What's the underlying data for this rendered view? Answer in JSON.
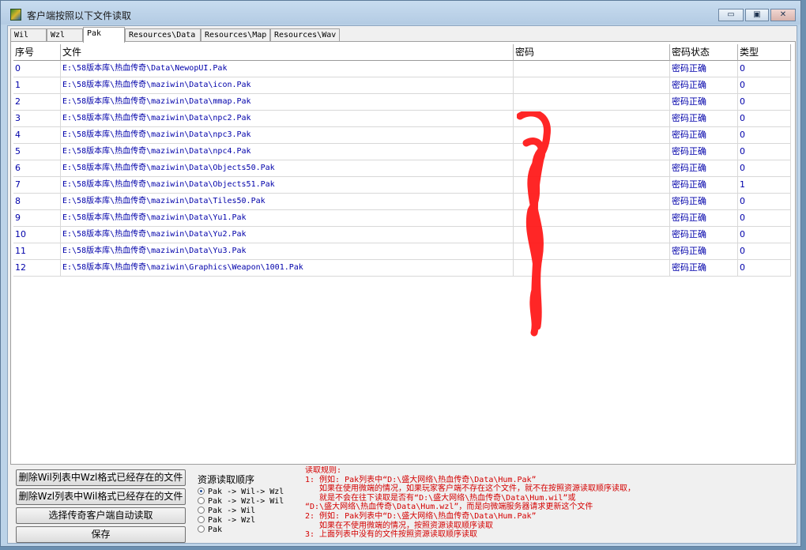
{
  "window": {
    "title": "客户端按照以下文件读取",
    "minimize_label": "▭",
    "maximize_label": "▣",
    "close_label": "✕"
  },
  "tabs": [
    {
      "label": "Wil"
    },
    {
      "label": "Wzl"
    },
    {
      "label": "Pak",
      "active": true
    },
    {
      "label": "Resources\\Data"
    },
    {
      "label": "Resources\\Map"
    },
    {
      "label": "Resources\\Wav"
    }
  ],
  "table": {
    "headers": [
      "序号",
      "文件",
      "密码",
      "密码状态",
      "类型"
    ],
    "rows": [
      {
        "index": "0",
        "file": "E:\\58版本库\\热血传奇\\Data\\NewopUI.Pak",
        "password": "",
        "status": "密码正确",
        "type": "0"
      },
      {
        "index": "1",
        "file": "E:\\58版本库\\热血传奇\\maziwin\\Data\\icon.Pak",
        "password": "",
        "status": "密码正确",
        "type": "0"
      },
      {
        "index": "2",
        "file": "E:\\58版本库\\热血传奇\\maziwin\\Data\\mmap.Pak",
        "password": "",
        "status": "密码正确",
        "type": "0"
      },
      {
        "index": "3",
        "file": "E:\\58版本库\\热血传奇\\maziwin\\Data\\npc2.Pak",
        "password": "",
        "status": "密码正确",
        "type": "0"
      },
      {
        "index": "4",
        "file": "E:\\58版本库\\热血传奇\\maziwin\\Data\\npc3.Pak",
        "password": "",
        "status": "密码正确",
        "type": "0"
      },
      {
        "index": "5",
        "file": "E:\\58版本库\\热血传奇\\maziwin\\Data\\npc4.Pak",
        "password": "",
        "status": "密码正确",
        "type": "0"
      },
      {
        "index": "6",
        "file": "E:\\58版本库\\热血传奇\\maziwin\\Data\\Objects50.Pak",
        "password": "",
        "status": "密码正确",
        "type": "0"
      },
      {
        "index": "7",
        "file": "E:\\58版本库\\热血传奇\\maziwin\\Data\\Objects51.Pak",
        "password": "",
        "status": "密码正确",
        "type": "1"
      },
      {
        "index": "8",
        "file": "E:\\58版本库\\热血传奇\\maziwin\\Data\\Tiles50.Pak",
        "password": "",
        "status": "密码正确",
        "type": "0"
      },
      {
        "index": "9",
        "file": "E:\\58版本库\\热血传奇\\maziwin\\Data\\Yu1.Pak",
        "password": "",
        "status": "密码正确",
        "type": "0"
      },
      {
        "index": "10",
        "file": "E:\\58版本库\\热血传奇\\maziwin\\Data\\Yu2.Pak",
        "password": "",
        "status": "密码正确",
        "type": "0"
      },
      {
        "index": "11",
        "file": "E:\\58版本库\\热血传奇\\maziwin\\Data\\Yu3.Pak",
        "password": "",
        "status": "密码正确",
        "type": "0"
      },
      {
        "index": "12",
        "file": "E:\\58版本库\\热血传奇\\maziwin\\Graphics\\Weapon\\1001.Pak",
        "password": "",
        "status": "密码正确",
        "type": "0"
      }
    ]
  },
  "buttons": {
    "delete_wil": "删除Wil列表中Wzl格式已经存在的文件",
    "delete_wzl": "删除Wzl列表中Wil格式已经存在的文件",
    "auto_read": "选择传奇客户端自动读取",
    "save": "保存"
  },
  "resource_order": {
    "title": "资源读取顺序",
    "options": [
      {
        "label": "Pak -> Wil-> Wzl",
        "selected": true
      },
      {
        "label": "Pak -> Wzl-> Wil",
        "selected": false
      },
      {
        "label": "Pak -> Wil",
        "selected": false
      },
      {
        "label": "Pak -> Wzl",
        "selected": false
      },
      {
        "label": "Pak",
        "selected": false
      }
    ]
  },
  "rules": {
    "title": "读取规则:",
    "line1": "1: 例如: Pak列表中“D:\\盛大网络\\热血传奇\\Data\\Hum.Pak”",
    "line2": "   如果在使用微端的情况，如果玩家客户端不存在这个文件，就不在按照资源读取顺序读取，",
    "line3": "   就是不会在往下读取是否有“D:\\盛大网络\\热血传奇\\Data\\Hum.wil”或",
    "line4": "“D:\\盛大网络\\热血传奇\\Data\\Hum.wzl”，而是向微端服务器请求更新这个文件",
    "line5": "2: 例如: Pak列表中“D:\\盛大网络\\热血传奇\\Data\\Hum.Pak”",
    "line6": "   如果在不使用微端的情况，按照资源读取顺序读取",
    "line7": "3: 上面列表中没有的文件按照资源读取顺序读取"
  },
  "colors": {
    "table_text": "#0000aa",
    "rules_text": "#d40000",
    "scribble": "#ff1a1a"
  }
}
